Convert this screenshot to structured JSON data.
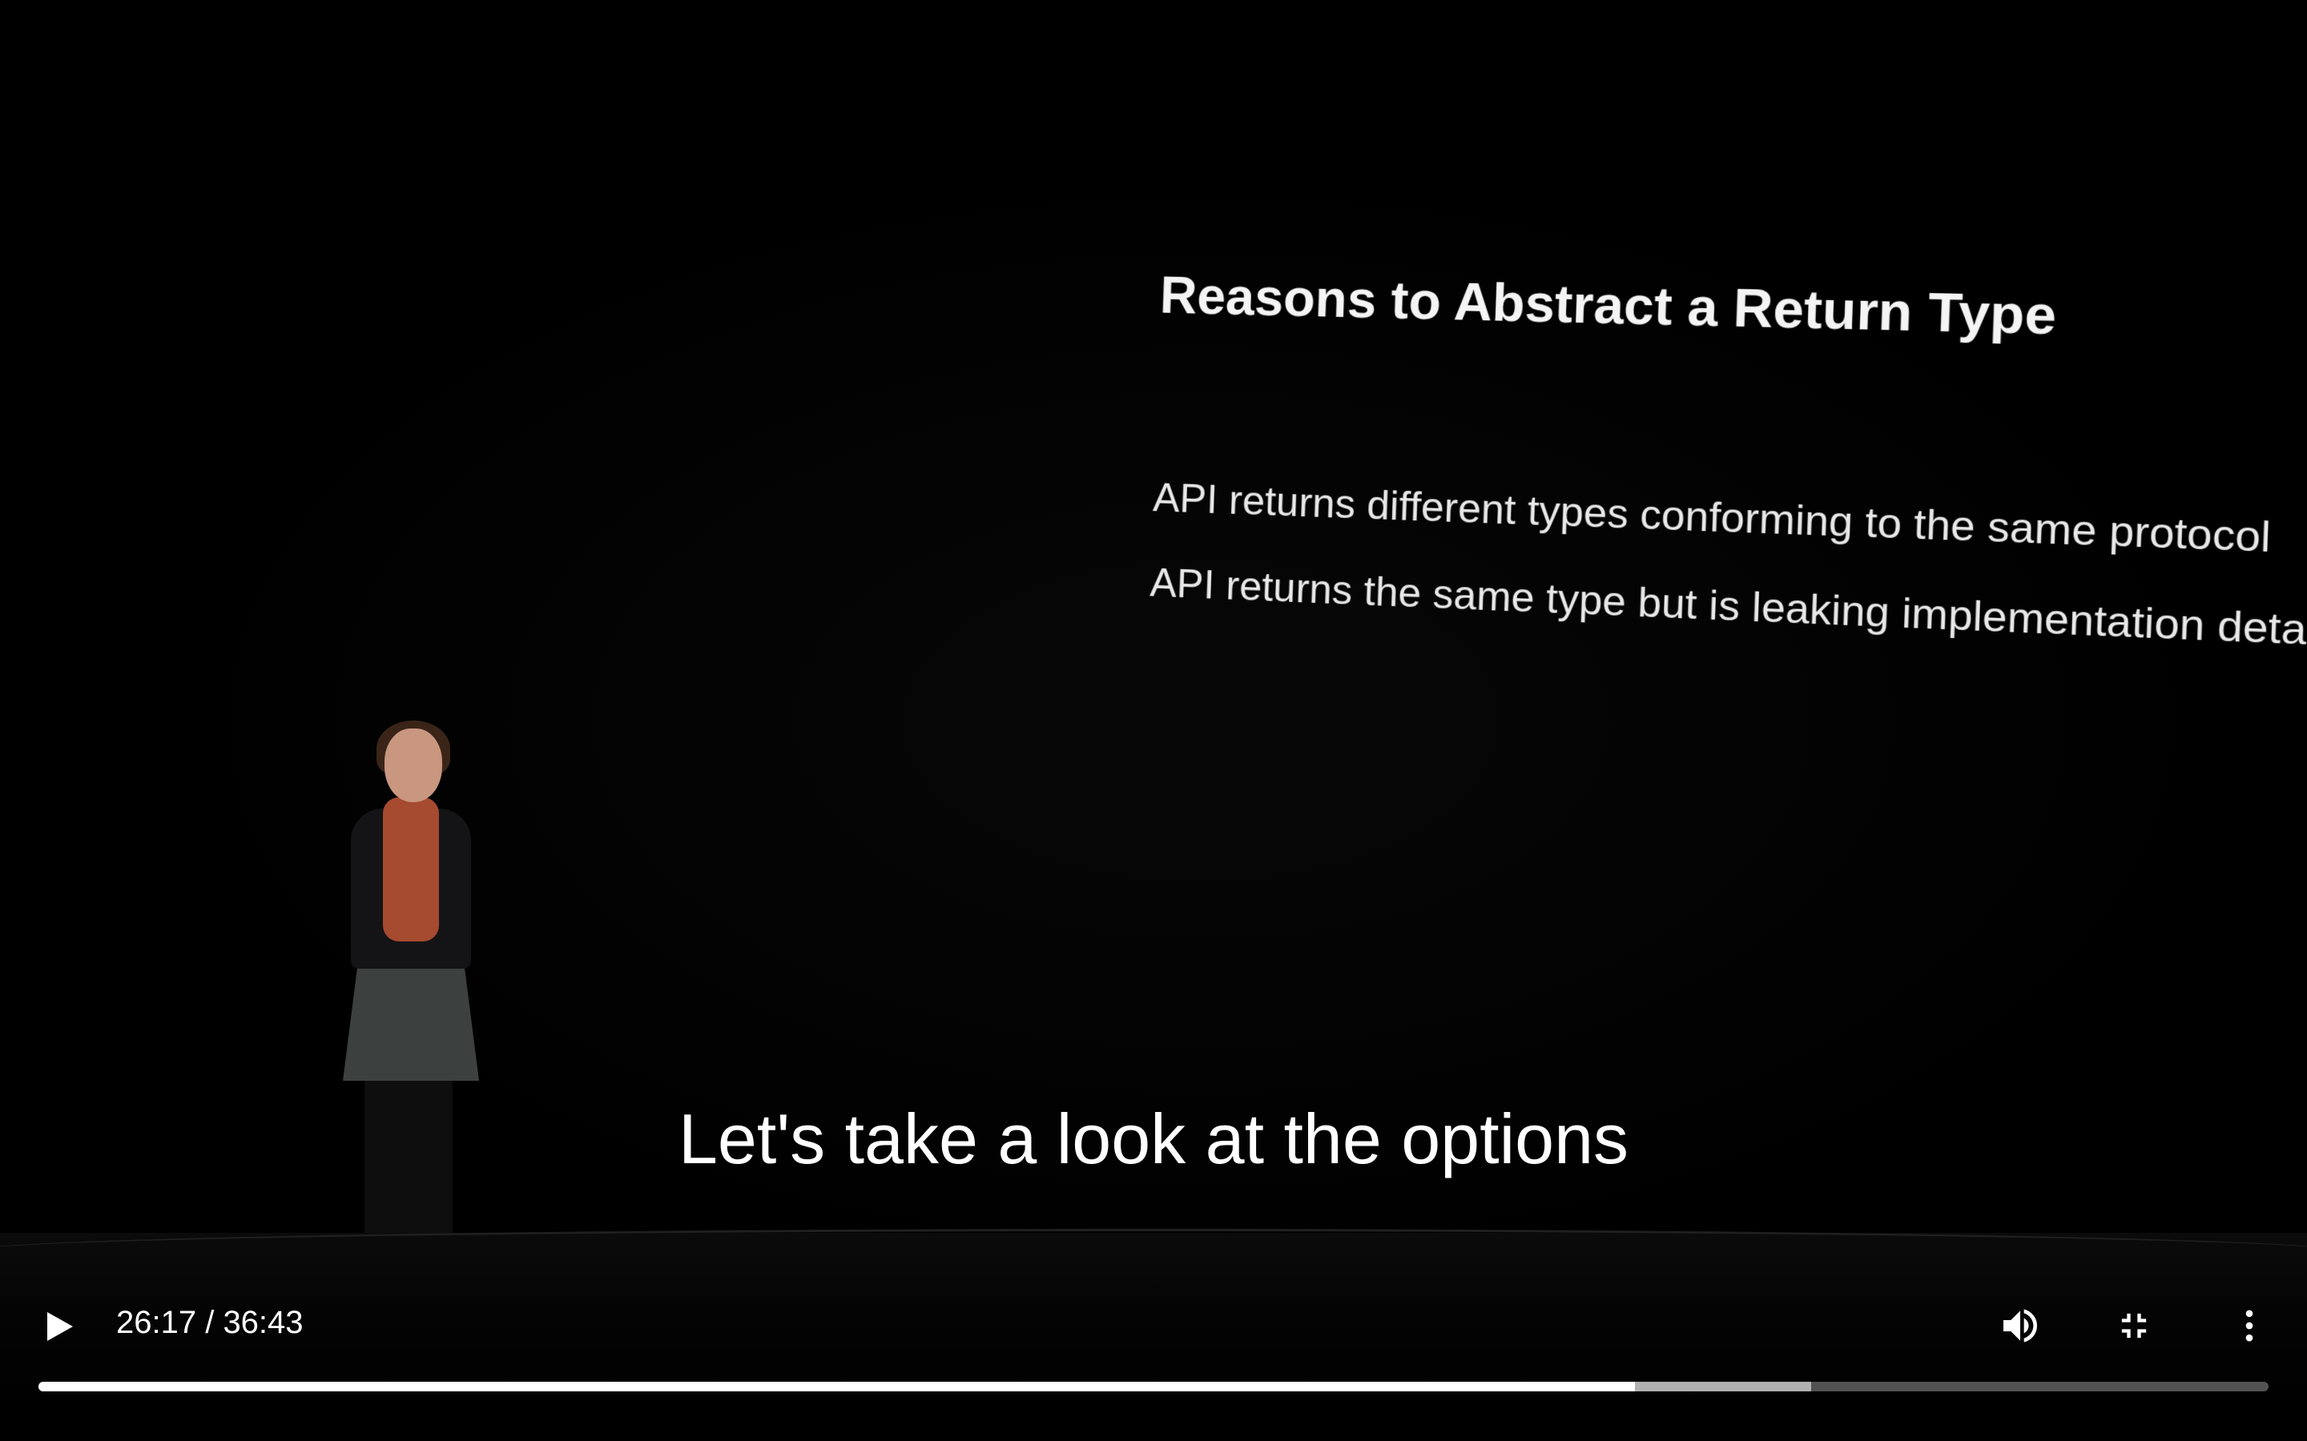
{
  "slide": {
    "title": "Reasons to Abstract a Return Type",
    "bullets": [
      "API returns different types conforming to the same protocol",
      "API returns the same type but is leaking implementation details"
    ]
  },
  "captions": {
    "text": "Let's take a look at the options"
  },
  "controls": {
    "play_icon": "play-icon",
    "current_time": "26:17",
    "duration": "36:43",
    "time_display": "26:17 / 36:43",
    "volume_icon": "volume-up-icon",
    "exit_fullscreen_icon": "exit-fullscreen-icon",
    "more_icon": "more-vertical-icon",
    "progress_played_fraction": 0.716,
    "progress_buffered_fraction": 0.795
  },
  "colors": {
    "background": "#000000",
    "progress_played": "#ffffff",
    "progress_track": "#5a5a5a",
    "scarf": "#a64a30"
  }
}
